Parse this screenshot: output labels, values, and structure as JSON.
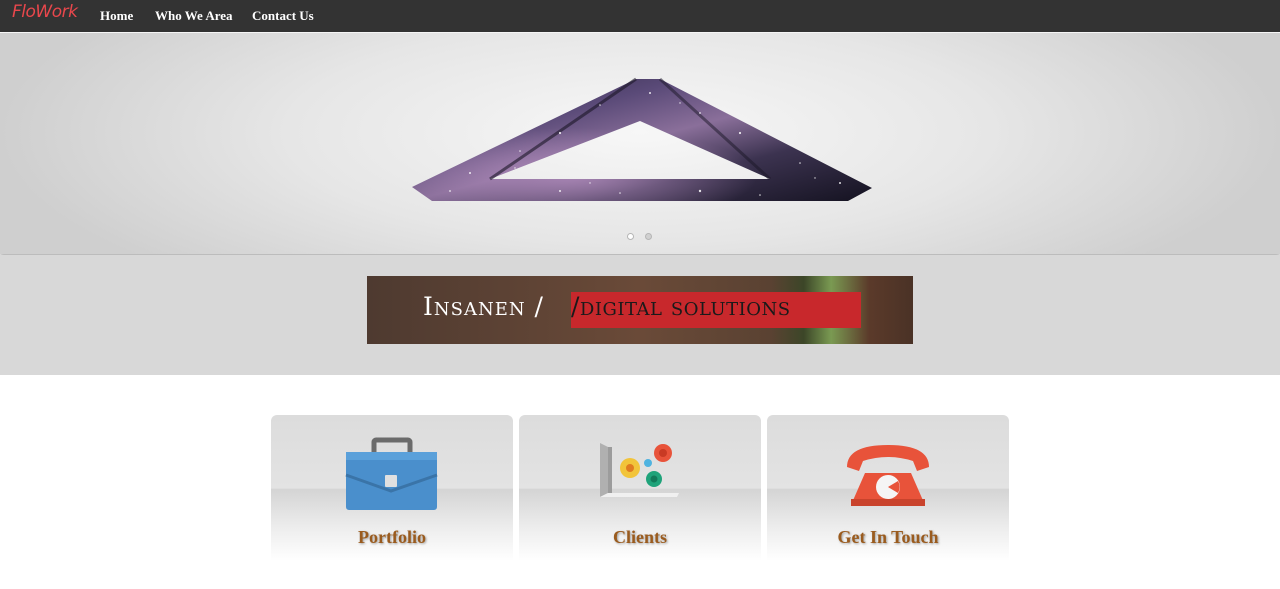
{
  "navbar": {
    "brand": "FloWork",
    "links": [
      "Home",
      "Who We Area",
      "Contact Us"
    ]
  },
  "carousel": {
    "slide_count": 2,
    "active_slide": 1
  },
  "banner": {
    "text_left": "Insanen /",
    "text_highlight": "/digital solutions"
  },
  "cards": [
    {
      "label": "Portfolio",
      "icon": "briefcase-icon"
    },
    {
      "label": "Clients",
      "icon": "clients-graph-icon"
    },
    {
      "label": "Get In Touch",
      "icon": "telephone-icon"
    }
  ],
  "colors": {
    "navbar": "#333333",
    "brand": "#e8474c",
    "banner_highlight": "#c8282c",
    "card_label": "#9a5b1e"
  }
}
